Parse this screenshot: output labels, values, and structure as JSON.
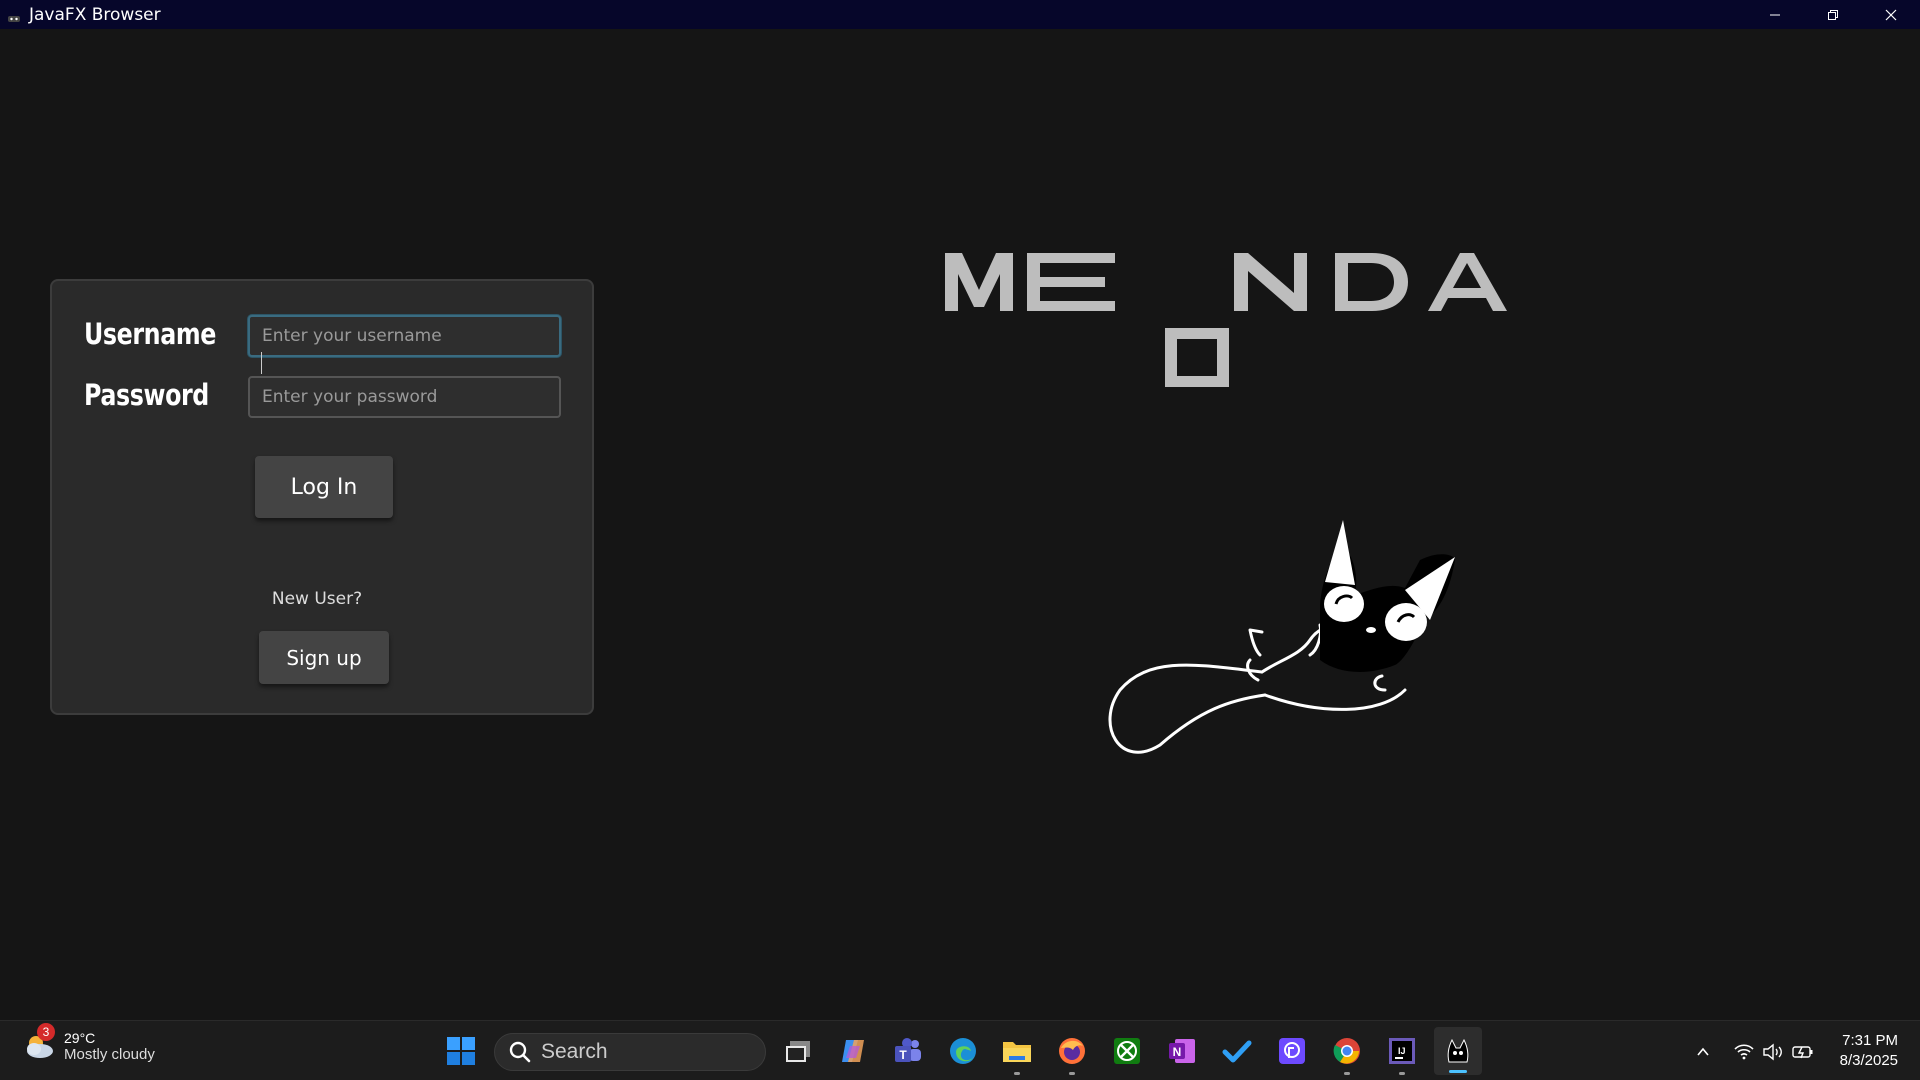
{
  "window": {
    "title": "JavaFX Browser",
    "controls": [
      "minimize",
      "restore",
      "close"
    ]
  },
  "login": {
    "username_label": "Username",
    "username_placeholder": "Enter your username",
    "username_value": "",
    "password_label": "Password",
    "password_placeholder": "Enter your password",
    "password_value": "",
    "login_button": "Log In",
    "new_user_text": "New User?",
    "signup_button": "Sign up"
  },
  "logo": {
    "word_top": "ME  NDA",
    "letters": [
      "M",
      "E",
      "N",
      "D",
      "A"
    ],
    "color": "#bdbdbd",
    "mascot": "cat-icon"
  },
  "taskbar": {
    "weather": {
      "badge": "3",
      "temp": "29°C",
      "condition": "Mostly cloudy",
      "icon": "cloudy-weather-icon"
    },
    "search_label": "Search",
    "apps": [
      "task-view-icon",
      "copilot-icon",
      "teams-icon",
      "edge-icon",
      "file-explorer-icon",
      "firefox-icon",
      "xbox-icon",
      "onenote-icon",
      "todo-icon",
      "proton-pass-icon",
      "chrome-icon",
      "intellij-icon",
      "javafx-app-icon"
    ],
    "clock": {
      "time": "7:31 PM",
      "date": "8/3/2025"
    },
    "accent": "#4cc2ff"
  }
}
